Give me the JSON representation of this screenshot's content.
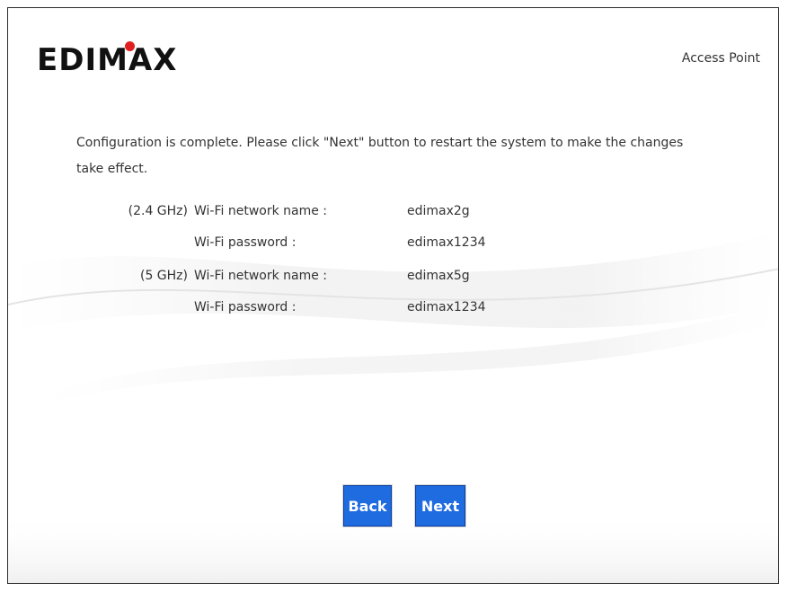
{
  "header": {
    "logo_text": "EDIMAX",
    "mode": "Access Point"
  },
  "message": "Configuration is complete. Please click \"Next\" button to restart the system to make the changes take effect.",
  "summary": [
    {
      "band": "(2.4 GHz)",
      "field": "Wi-Fi network name :",
      "value": "edimax2g"
    },
    {
      "band": "",
      "field": "Wi-Fi password :",
      "value": "edimax1234"
    },
    {
      "band": "(5 GHz)",
      "field": "Wi-Fi network name :",
      "value": "edimax5g"
    },
    {
      "band": "",
      "field": "Wi-Fi password :",
      "value": "edimax1234"
    }
  ],
  "buttons": {
    "back": "Back",
    "next": "Next"
  },
  "colors": {
    "button_blue": "#1f6be0",
    "logo_dot_red": "#e02020"
  }
}
